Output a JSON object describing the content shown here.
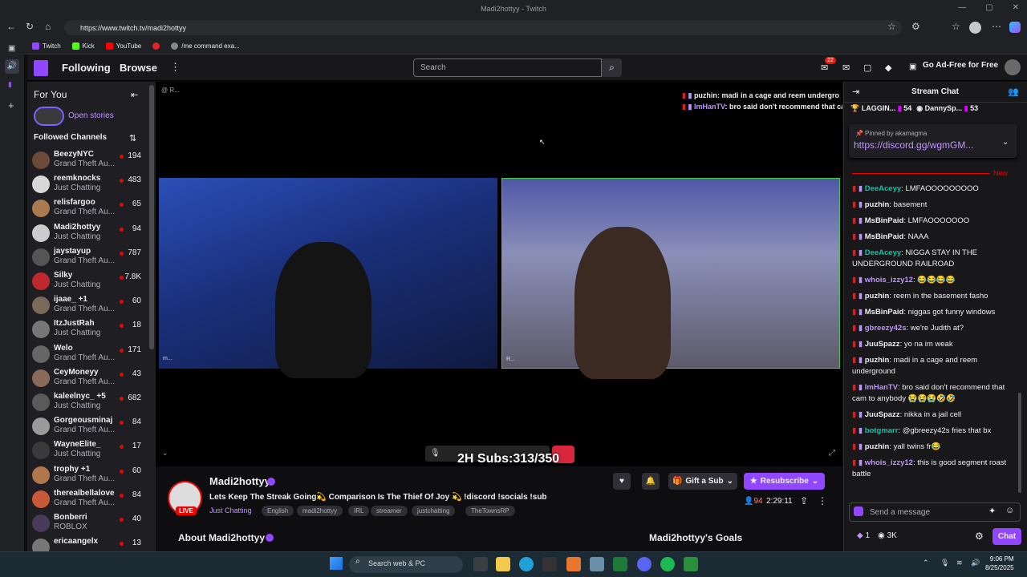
{
  "window": {
    "title": "Madi2hottyy - Twitch"
  },
  "browser": {
    "url": "https://www.twitch.tv/madi2hottyy",
    "bookmarks": [
      "Twitch",
      "Kick",
      "YouTube",
      "",
      "/me command exa..."
    ]
  },
  "nav": {
    "following": "Following",
    "browse": "Browse",
    "search_placeholder": "Search",
    "notif_count": "22",
    "ad_free": "Go Ad-Free for Free"
  },
  "sidebar": {
    "for_you": "For You",
    "open_stories": "Open stories",
    "followed_heading": "Followed Channels",
    "channels": [
      {
        "name": "BeezyNYC",
        "game": "Grand Theft Au...",
        "viewers": "194"
      },
      {
        "name": "reemknocks",
        "game": "Just Chatting",
        "viewers": "483"
      },
      {
        "name": "relisfargoo",
        "game": "Grand Theft Au...",
        "viewers": "65"
      },
      {
        "name": "Madi2hottyy",
        "game": "Just Chatting",
        "viewers": "94"
      },
      {
        "name": "jaystayup",
        "game": "Grand Theft Au...",
        "viewers": "787"
      },
      {
        "name": "Silky",
        "game": "Just Chatting",
        "viewers": "7.8K"
      },
      {
        "name": "ijaae_ +1",
        "game": "Grand Theft Au...",
        "viewers": "60"
      },
      {
        "name": "ItzJustRah",
        "game": "Just Chatting",
        "viewers": "18"
      },
      {
        "name": "Welo",
        "game": "Grand Theft Au...",
        "viewers": "171"
      },
      {
        "name": "CeyMoneyy",
        "game": "Grand Theft Au...",
        "viewers": "43"
      },
      {
        "name": "kaleelnyc_ +5",
        "game": "Just Chatting",
        "viewers": "682"
      },
      {
        "name": "Gorgeousminaj",
        "game": "Grand Theft Au...",
        "viewers": "84"
      },
      {
        "name": "WayneElite_",
        "game": "Just Chatting",
        "viewers": "17"
      },
      {
        "name": "trophy +1",
        "game": "Grand Theft Au...",
        "viewers": "60"
      },
      {
        "name": "therealbellalove",
        "game": "Grand Theft Au...",
        "viewers": "84"
      },
      {
        "name": "Bonberri",
        "game": "ROBLOX",
        "viewers": "40"
      },
      {
        "name": "ericaangelx",
        "game": "",
        "viewers": "13"
      }
    ]
  },
  "player": {
    "overlay_chat": [
      {
        "user": "puzhin",
        "text": "madi in a cage and reem undergro",
        "color": "#efeff1"
      },
      {
        "user": "ImHanTV",
        "text": "bro said don't recommend that ca",
        "color": "#bf94ff"
      }
    ],
    "subs_text": "2H Subs:313/350",
    "corner_text": "@ R...",
    "cam_label_1": "m...",
    "cam_label_2": "R..."
  },
  "channel": {
    "name": "Madi2hottyy",
    "live": "LIVE",
    "title": "Lets Keep The Streak Going💫 Comparison Is The Thief Of Joy 💫 !discord !socials !sub",
    "category": "Just Chatting",
    "tags": [
      "English",
      "madi2hottyy",
      "IRL",
      "streamer",
      "justchatting",
      "TheTownsRP"
    ],
    "gift_sub": "Gift a Sub",
    "resubscribe": "Resubscribe",
    "viewers": "94",
    "uptime": "2:29:11",
    "about": "About Madi2hottyy",
    "goals": "Madi2hottyy's Goals"
  },
  "chat": {
    "title": "Stream Chat",
    "leaders": [
      {
        "name": "LAGGIN...",
        "value": "54"
      },
      {
        "name": "DannySp...",
        "value": "53"
      }
    ],
    "pinned_by": "Pinned by akamagma",
    "pinned_link": "https://discord.gg/wgmGM...",
    "new_label": "New",
    "messages": [
      {
        "user": "DeeAceyy",
        "text": "LMFAOOOOOOOOO",
        "color": "#00c8af"
      },
      {
        "user": "puzhin",
        "text": "basement",
        "color": "#efeff1"
      },
      {
        "user": "MsBinPaid",
        "text": "LMFAOOOOOOO",
        "color": "#efeff1"
      },
      {
        "user": "MsBinPaid",
        "text": "NAAA",
        "color": "#efeff1"
      },
      {
        "user": "DeeAceyy",
        "text": "NIGGA STAY IN THE UNDERGROUND RAILROAD",
        "color": "#00c8af"
      },
      {
        "user": "whois_izzy12",
        "text": "😂😂😂😂",
        "color": "#bf94ff"
      },
      {
        "user": "puzhin",
        "text": "reem in the basement fasho",
        "color": "#efeff1"
      },
      {
        "user": "MsBinPaid",
        "text": "niggas got funny windows",
        "color": "#efeff1"
      },
      {
        "user": "gbreezy42s",
        "text": "we're Judith at?",
        "color": "#bf94ff"
      },
      {
        "user": "JuuSpazz",
        "text": "yo na im weak",
        "color": "#efeff1"
      },
      {
        "user": "puzhin",
        "text": "madi in a cage and reem underground",
        "color": "#efeff1"
      },
      {
        "user": "ImHanTV",
        "text": "bro said don't recommend that cam to anybody 😭😭😭🤣🤣",
        "color": "#bf94ff"
      },
      {
        "user": "JuuSpazz",
        "text": "nikka in a jail cell",
        "color": "#efeff1"
      },
      {
        "user": "botgmarr",
        "text": "@gbreezy42s fries that bx",
        "color": "#00c8af"
      },
      {
        "user": "puzhin",
        "text": "yall twins fr😂",
        "color": "#efeff1"
      },
      {
        "user": "whois_izzy12",
        "text": "this is good segment roast battle",
        "color": "#bf94ff"
      }
    ],
    "input_placeholder": "Send a message",
    "points_a": "1",
    "points_b": "3K",
    "chat_button": "Chat"
  },
  "taskbar": {
    "search": "Search web & PC",
    "time": "9:06 PM",
    "date": "8/25/2025"
  }
}
